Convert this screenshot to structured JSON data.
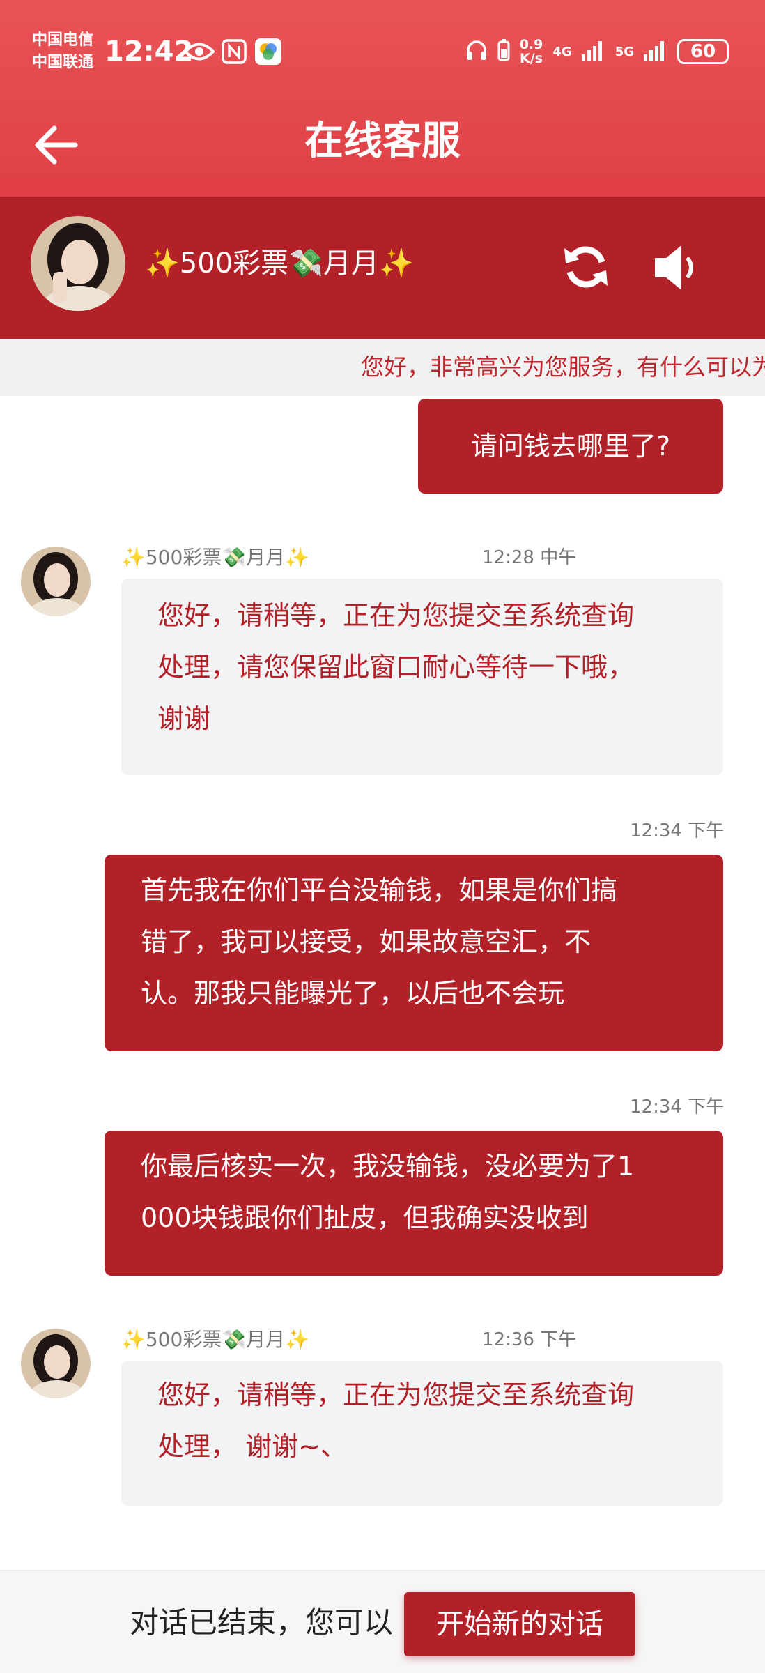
{
  "status_bar": {
    "carrier_1": "中国电信",
    "carrier_2": "中国联通",
    "time": "12:42",
    "speed_value": "0.9",
    "speed_unit": "K/s",
    "net_1": "4G",
    "net_2": "5G",
    "battery": "60"
  },
  "header": {
    "title": "在线客服"
  },
  "agent": {
    "name": "✨500彩票💸月月✨"
  },
  "marquee": {
    "text": "您好，非常高兴为您服务，有什么可以为"
  },
  "messages": [
    {
      "direction": "out",
      "text": "请问钱去哪里了?"
    },
    {
      "direction": "in",
      "sender": "✨500彩票💸月月✨",
      "time": "12:28 中午",
      "lines": [
        "您好，请稍等，正在为您提交至系统查询",
        "处理，请您保留此窗口耐心等待一下哦，",
        "谢谢"
      ]
    },
    {
      "direction": "out",
      "time": "12:34 下午",
      "lines": [
        "首先我在你们平台没输钱，如果是你们搞",
        "错了，我可以接受，如果故意空汇，不",
        "认。那我只能曝光了，以后也不会玩"
      ]
    },
    {
      "direction": "out",
      "time": "12:34 下午",
      "lines": [
        "你最后核实一次，我没输钱，没必要为了1",
        "000块钱跟你们扯皮，但我确实没收到"
      ]
    },
    {
      "direction": "in",
      "sender": "✨500彩票💸月月✨",
      "time": "12:36 下午",
      "lines": [
        "您好，请稍等，正在为您提交至系统查询",
        "处理， 谢谢~、"
      ]
    }
  ],
  "footer": {
    "text": "对话已结束，您可以",
    "button": "开始新的对话"
  },
  "colors": {
    "header_red": "#df3f45",
    "agent_bar_red": "#b32128",
    "incoming_bg": "#f2f3f5"
  },
  "icons": [
    "eye-icon",
    "nfc-icon",
    "app-icon",
    "headphones-icon",
    "battery-small-icon",
    "signal-icon",
    "back-arrow-icon",
    "refresh-icon",
    "volume-icon"
  ]
}
